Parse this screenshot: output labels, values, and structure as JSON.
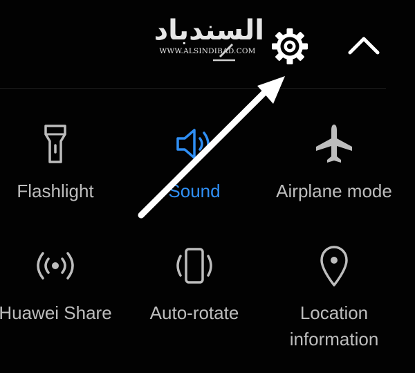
{
  "watermark": {
    "arabic": "السندباد",
    "url": "WWW.ALSINDIBAD.COM"
  },
  "header": {
    "icons": [
      "edit-icon",
      "gear-icon",
      "chevron-up-icon"
    ]
  },
  "tiles": [
    {
      "label": "Flashlight",
      "icon": "flashlight-icon",
      "active": false
    },
    {
      "label": "Sound",
      "icon": "speaker-icon",
      "active": true
    },
    {
      "label": "Airplane mode",
      "icon": "airplane-icon",
      "active": false
    },
    {
      "label": "Huawei Share",
      "icon": "wireless-share-icon",
      "active": false
    },
    {
      "label": "Auto-rotate",
      "icon": "auto-rotate-icon",
      "active": false
    },
    {
      "label": "Location",
      "label_line2": "information",
      "icon": "location-pin-icon",
      "active": false
    }
  ],
  "colors": {
    "background": "#000000",
    "active": "#2f8ff5",
    "inactive": "#bdbdbd",
    "annotation_arrow": "#ffffff"
  }
}
